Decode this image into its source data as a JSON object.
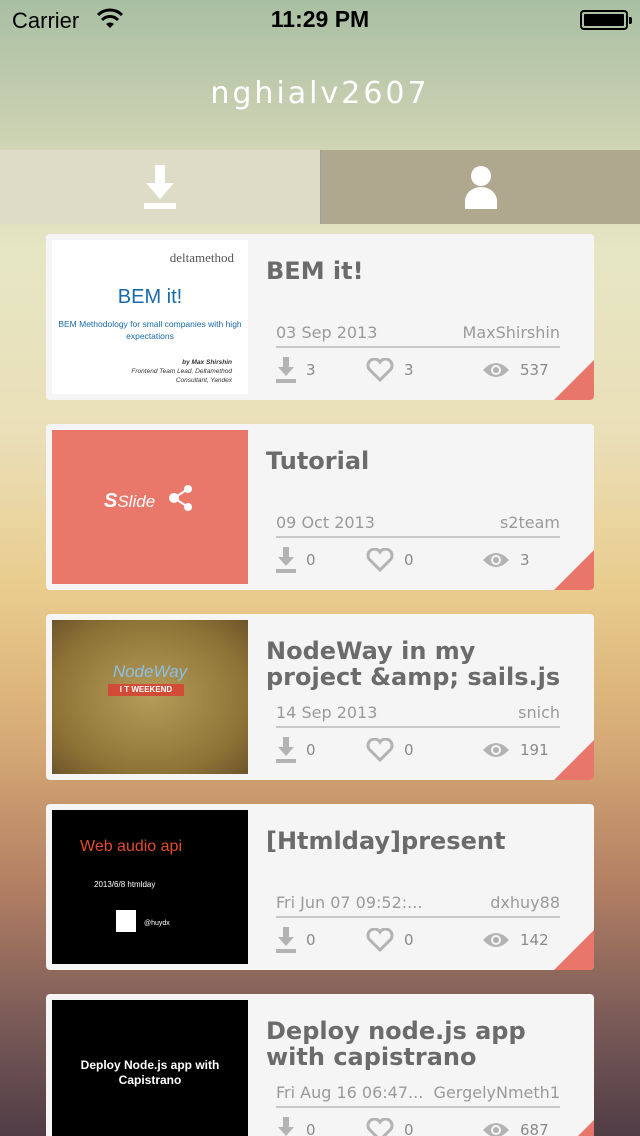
{
  "status_bar": {
    "carrier": "Carrier",
    "time": "11:29 PM"
  },
  "header": {
    "title": "nghialv2607"
  },
  "tabs": [
    {
      "icon": "download-icon"
    },
    {
      "icon": "user-icon"
    }
  ],
  "colors": {
    "accent": "#e9766a",
    "card_bg": "#f5f5f5",
    "text_gray": "#6b6b6b"
  },
  "slides": [
    {
      "title": "BEM it!",
      "date": "03 Sep 2013",
      "author": "MaxShirshin",
      "downloads": "3",
      "likes": "3",
      "views": "537",
      "thumb": {
        "brand": "deltamethod",
        "big": "BEM it!",
        "sub": "BEM Methodology for small companies with high expectations",
        "auth_name": "by Max Shirshin",
        "auth_role": "Frontend Team Lead, Deltamethod",
        "auth_extra": "Consultant, Yandex"
      }
    },
    {
      "title": "Tutorial",
      "date": "09 Oct 2013",
      "author": "s2team",
      "downloads": "0",
      "likes": "0",
      "views": "3",
      "thumb": {
        "logo": "Slide"
      }
    },
    {
      "title": "NodeWay in my project &amp; sails.js",
      "date": "14 Sep 2013",
      "author": "snich",
      "downloads": "0",
      "likes": "0",
      "views": "191",
      "thumb": {
        "nodeway": "NodeWay",
        "itweekend": "I T WEEKEND"
      }
    },
    {
      "title": "[Htmlday]present",
      "date": "Fri Jun 07 09:52:...",
      "author": "dxhuy88",
      "downloads": "0",
      "likes": "0",
      "views": "142",
      "thumb": {
        "heading": "Web audio api",
        "date": "2013/6/8 htmlday",
        "handle": "@huydx"
      }
    },
    {
      "title": "Deploy node.js app with capistrano",
      "date": "Fri Aug 16 06:47...",
      "author": "GergelyNmeth1",
      "downloads": "0",
      "likes": "0",
      "views": "687",
      "thumb": {
        "text": "Deploy Node.js app with Capistrano"
      }
    }
  ]
}
